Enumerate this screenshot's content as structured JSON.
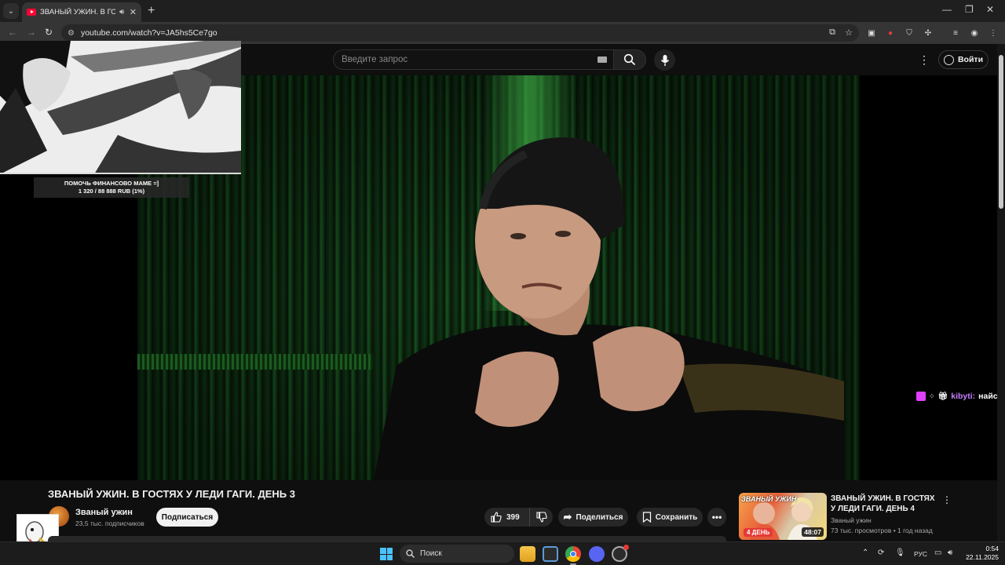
{
  "browser": {
    "tab_title": "ЗВАНЫЙ УЖИН. В ГОСТЯХ",
    "url": "youtube.com/watch?v=JA5hs5Ce7go",
    "new_tab": "+",
    "minimize": "—",
    "restore": "❐",
    "close": "✕"
  },
  "youtube": {
    "search_placeholder": "Введите запрос",
    "sign_in": "Войти"
  },
  "overlay": {
    "donation_line1": "ПОМОЧЬ ФИНАНСОВО МАМЕ =]",
    "donation_line2": "1 320 / 88 888 RUB (1%)",
    "donation_progress": 0.01,
    "chat_user": "kibyti:",
    "chat_text": "найс"
  },
  "video": {
    "title": "ЗВАНЫЙ УЖИН. В ГОСТЯХ У ЛЕДИ ГАГИ. ДЕНЬ 3",
    "channel_name": "Званый ужин",
    "subscribers": "23,5 тыс. подписчиков",
    "subscribe_label": "Подписаться",
    "likes": "399",
    "share_label": "Поделиться",
    "save_label": "Сохранить"
  },
  "related": {
    "title": "ЗВАНЫЙ УЖИН. В ГОСТЯХ У ЛЕДИ ГАГИ. ДЕНЬ 4",
    "channel": "Званый ужин",
    "meta": "73 тыс. просмотров • 1 год назад",
    "duration": "48:07",
    "thumb_badge": "ЗВАНЫЙ УЖИН",
    "thumb_day": "4 ДЕНЬ"
  },
  "taskbar": {
    "search_label": "Поиск",
    "language": "РУС",
    "time": "0:54",
    "date": "22.11.2025"
  },
  "colors": {
    "accent_red": "#ff0033",
    "windows_blue": "#4cc2ff",
    "chat_pink": "#c77dff"
  }
}
